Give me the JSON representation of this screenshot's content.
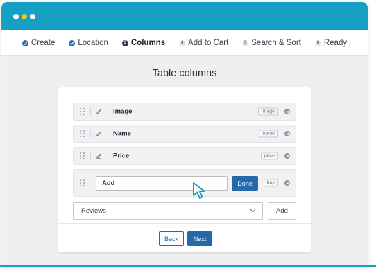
{
  "window": {
    "dots": [
      "#ffffff",
      "#f5c518",
      "#ffffff"
    ],
    "accent": "#16a0c4",
    "primary": "#2569aa"
  },
  "steps": [
    {
      "label": "Create",
      "marker": "",
      "state": "done"
    },
    {
      "label": "Location",
      "marker": "",
      "state": "done"
    },
    {
      "label": "Columns",
      "marker": "3",
      "state": "current"
    },
    {
      "label": "Add to Cart",
      "marker": "4",
      "state": "todo"
    },
    {
      "label": "Search & Sort",
      "marker": "5",
      "state": "todo"
    },
    {
      "label": "Ready",
      "marker": "6",
      "state": "todo"
    }
  ],
  "page": {
    "heading": "Table columns"
  },
  "columns": [
    {
      "label": "Image",
      "slug": "image"
    },
    {
      "label": "Name",
      "slug": "name"
    },
    {
      "label": "Price",
      "slug": "price"
    }
  ],
  "editing": {
    "value": "Add",
    "done_label": "Done",
    "slug": "buy"
  },
  "add_column": {
    "selected": "Reviews",
    "add_label": "Add"
  },
  "nav": {
    "back_label": "Back",
    "next_label": "Next"
  }
}
